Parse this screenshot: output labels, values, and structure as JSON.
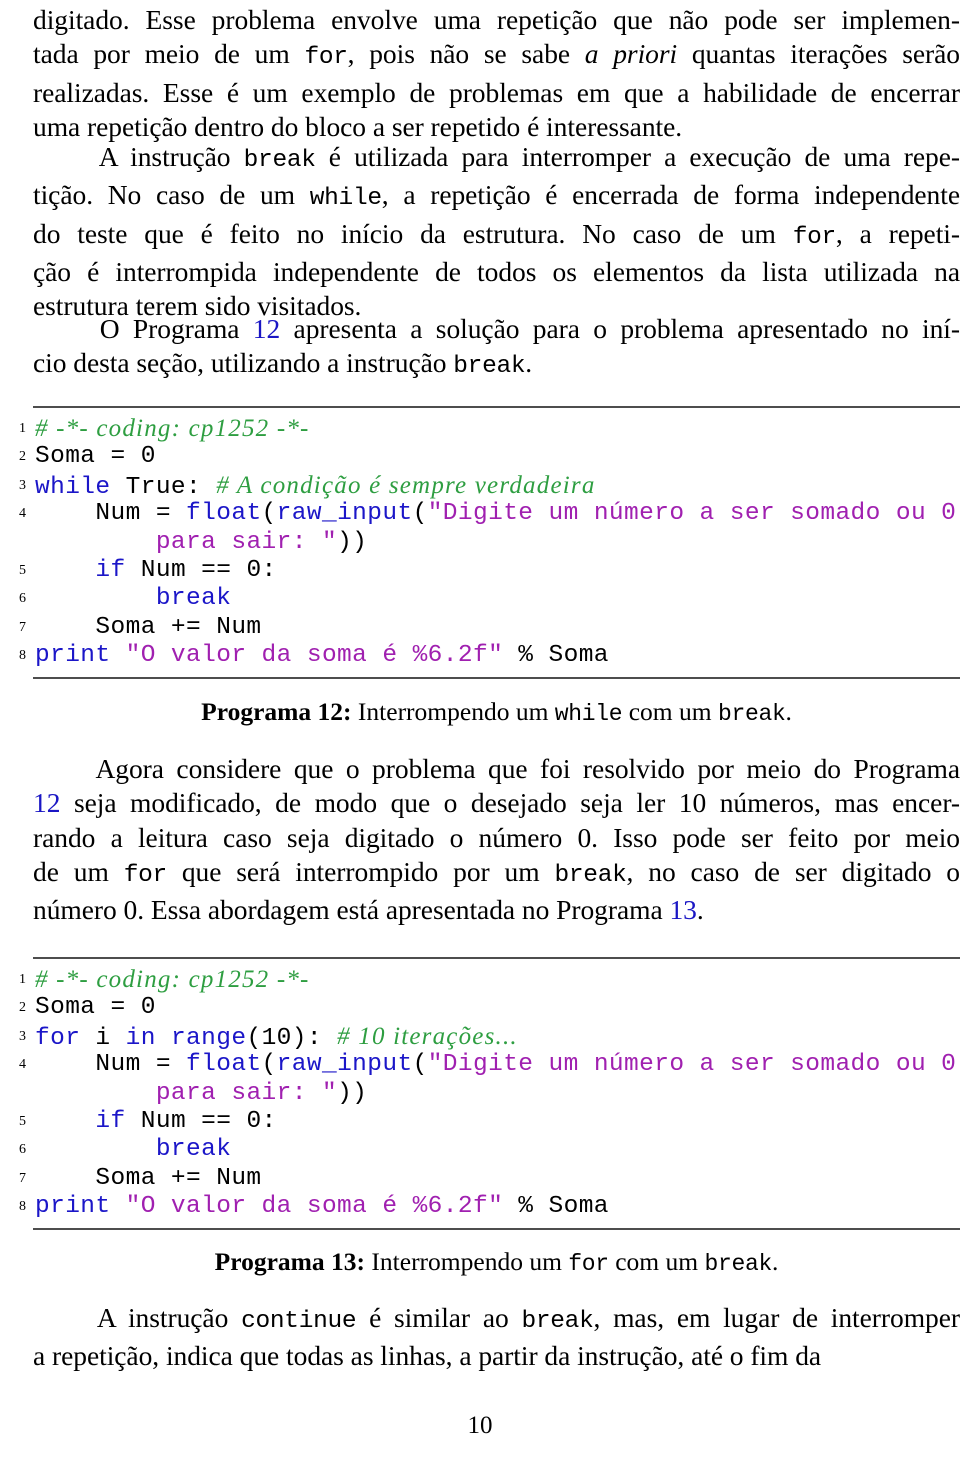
{
  "document": {
    "page_number": "10",
    "link_color": "#1a16c4",
    "code_colors": {
      "keyword": "#1b16c8",
      "builtin": "#1b16c8",
      "string": "#a020b0",
      "comment": "#2e9e41",
      "normal": "#000000",
      "rule": "#4d4d4d"
    }
  },
  "paragraphs": {
    "p1": {
      "lines": [
        [
          {
            "t": "digitado. Esse problema envolve uma repetição que não pode ser implemen-",
            "st": "r"
          }
        ],
        [
          {
            "t": "tada por meio de um ",
            "st": "r"
          },
          {
            "t": "for",
            "st": "tt"
          },
          {
            "t": ", pois não se sabe ",
            "st": "r"
          },
          {
            "t": "a priori",
            "st": "it"
          },
          {
            "t": " quantas iterações serão",
            "st": "r"
          }
        ],
        [
          {
            "t": "realizadas. Esse é um exemplo de problemas em que a habilidade de encerrar",
            "st": "r"
          }
        ],
        [
          {
            "t": "uma repetição dentro do bloco a ser repetido é interessante.",
            "st": "r"
          }
        ]
      ]
    },
    "p2": {
      "lines": [
        [
          {
            "t": "     A instrução ",
            "st": "r"
          },
          {
            "t": "break",
            "st": "tt"
          },
          {
            "t": " é utilizada para interromper a execução de uma repe-",
            "st": "r"
          }
        ],
        [
          {
            "t": "tição. No caso de um ",
            "st": "r"
          },
          {
            "t": "while",
            "st": "tt"
          },
          {
            "t": ", a repetição é encerrada de forma independente",
            "st": "r"
          }
        ],
        [
          {
            "t": "do teste que é feito no início da estrutura. No caso de um ",
            "st": "r"
          },
          {
            "t": "for",
            "st": "tt"
          },
          {
            "t": ", a repeti-",
            "st": "r"
          }
        ],
        [
          {
            "t": "ção é interrompida independente de todos os elementos da lista utilizada na",
            "st": "r"
          }
        ],
        [
          {
            "t": "estrutura terem sido visitados.",
            "st": "r"
          }
        ]
      ]
    },
    "p3": {
      "lines": [
        [
          {
            "t": "     O Programa ",
            "st": "r"
          },
          {
            "t": "12",
            "st": "ref"
          },
          {
            "t": " apresenta a solução para o problema apresentado no iní-",
            "st": "r"
          }
        ],
        [
          {
            "t": "cio desta seção, utilizando a instrução ",
            "st": "r"
          },
          {
            "t": "break",
            "st": "tt"
          },
          {
            "t": ".",
            "st": "r"
          }
        ]
      ]
    },
    "p4": {
      "lines": [
        [
          {
            "t": "     Agora considere que o problema que foi resolvido por meio do Programa",
            "st": "r"
          }
        ],
        [
          {
            "t": "12",
            "st": "ref"
          },
          {
            "t": " seja modificado, de modo que o desejado seja ler 10 números, mas encer-",
            "st": "r"
          }
        ],
        [
          {
            "t": "rando a leitura caso seja digitado o número 0. Isso pode ser feito por meio",
            "st": "r"
          }
        ],
        [
          {
            "t": "de um ",
            "st": "r"
          },
          {
            "t": "for",
            "st": "tt"
          },
          {
            "t": " que será interrompido por um ",
            "st": "r"
          },
          {
            "t": "break",
            "st": "tt"
          },
          {
            "t": ", no caso de ser digitado o",
            "st": "r"
          }
        ],
        [
          {
            "t": "número 0. Essa abordagem está apresentada no Programa ",
            "st": "r"
          },
          {
            "t": "13",
            "st": "ref"
          },
          {
            "t": ".",
            "st": "r"
          }
        ]
      ]
    },
    "p5": {
      "lines": [
        [
          {
            "t": "     A instrução ",
            "st": "r"
          },
          {
            "t": "continue",
            "st": "tt"
          },
          {
            "t": " é similar ao ",
            "st": "r"
          },
          {
            "t": "break",
            "st": "tt"
          },
          {
            "t": ", mas, em lugar de interromper",
            "st": "r"
          }
        ],
        [
          {
            "t": "a repetição, indica que todas as linhas, a partir da instrução, até o fim da",
            "st": "r"
          }
        ]
      ]
    }
  },
  "listing1": {
    "id": "programa-12",
    "lines": [
      {
        "no": "1",
        "tokens": [
          {
            "t": "# -*- coding: cp1252 -*-",
            "c": "c"
          }
        ]
      },
      {
        "no": "2",
        "tokens": [
          {
            "t": "Soma = 0",
            "c": "n"
          }
        ]
      },
      {
        "no": "3",
        "tokens": [
          {
            "t": "while",
            "c": "k"
          },
          {
            "t": " True: ",
            "c": "n"
          },
          {
            "t": "# A condição é sempre verdadeira",
            "c": "c"
          }
        ]
      },
      {
        "no": "4",
        "tokens": [
          {
            "t": "    Num = ",
            "c": "n"
          },
          {
            "t": "float",
            "c": "fn"
          },
          {
            "t": "(",
            "c": "n"
          },
          {
            "t": "raw_input",
            "c": "fn"
          },
          {
            "t": "(",
            "c": "n"
          },
          {
            "t": "\"Digite um número a ser somado ou 0",
            "c": "s"
          }
        ]
      },
      {
        "no": "",
        "tokens": [
          {
            "t": "        ",
            "c": "n"
          },
          {
            "t": "para sair: \"",
            "c": "s"
          },
          {
            "t": "))",
            "c": "n"
          }
        ]
      },
      {
        "no": "5",
        "tokens": [
          {
            "t": "    ",
            "c": "n"
          },
          {
            "t": "if",
            "c": "k"
          },
          {
            "t": " Num == 0:",
            "c": "n"
          }
        ]
      },
      {
        "no": "6",
        "tokens": [
          {
            "t": "        ",
            "c": "n"
          },
          {
            "t": "break",
            "c": "k"
          }
        ]
      },
      {
        "no": "7",
        "tokens": [
          {
            "t": "    Soma += Num",
            "c": "n"
          }
        ]
      },
      {
        "no": "8",
        "tokens": [
          {
            "t": "print",
            "c": "k"
          },
          {
            "t": " ",
            "c": "n"
          },
          {
            "t": "\"O valor da soma é %6.2f\"",
            "c": "s"
          },
          {
            "t": " % Soma",
            "c": "n"
          }
        ]
      }
    ]
  },
  "caption1": {
    "label": "Programa 12:",
    "text_before": " Interrompendo um ",
    "code1": "while",
    "text_middle": " com um ",
    "code2": "break",
    "text_after": "."
  },
  "listing2": {
    "id": "programa-13",
    "lines": [
      {
        "no": "1",
        "tokens": [
          {
            "t": "# -*- coding: cp1252 -*-",
            "c": "c"
          }
        ]
      },
      {
        "no": "2",
        "tokens": [
          {
            "t": "Soma = 0",
            "c": "n"
          }
        ]
      },
      {
        "no": "3",
        "tokens": [
          {
            "t": "for",
            "c": "k"
          },
          {
            "t": " i ",
            "c": "n"
          },
          {
            "t": "in",
            "c": "k"
          },
          {
            "t": " ",
            "c": "n"
          },
          {
            "t": "range",
            "c": "fn"
          },
          {
            "t": "(10): ",
            "c": "n"
          },
          {
            "t": "# 10 iterações...",
            "c": "c"
          }
        ]
      },
      {
        "no": "4",
        "tokens": [
          {
            "t": "    Num = ",
            "c": "n"
          },
          {
            "t": "float",
            "c": "fn"
          },
          {
            "t": "(",
            "c": "n"
          },
          {
            "t": "raw_input",
            "c": "fn"
          },
          {
            "t": "(",
            "c": "n"
          },
          {
            "t": "\"Digite um número a ser somado ou 0",
            "c": "s"
          }
        ]
      },
      {
        "no": "",
        "tokens": [
          {
            "t": "        ",
            "c": "n"
          },
          {
            "t": "para sair: \"",
            "c": "s"
          },
          {
            "t": "))",
            "c": "n"
          }
        ]
      },
      {
        "no": "5",
        "tokens": [
          {
            "t": "    ",
            "c": "n"
          },
          {
            "t": "if",
            "c": "k"
          },
          {
            "t": " Num == 0:",
            "c": "n"
          }
        ]
      },
      {
        "no": "6",
        "tokens": [
          {
            "t": "        ",
            "c": "n"
          },
          {
            "t": "break",
            "c": "k"
          }
        ]
      },
      {
        "no": "7",
        "tokens": [
          {
            "t": "    Soma += Num",
            "c": "n"
          }
        ]
      },
      {
        "no": "8",
        "tokens": [
          {
            "t": "print",
            "c": "k"
          },
          {
            "t": " ",
            "c": "n"
          },
          {
            "t": "\"O valor da soma é %6.2f\"",
            "c": "s"
          },
          {
            "t": " % Soma",
            "c": "n"
          }
        ]
      }
    ]
  },
  "caption2": {
    "label": "Programa 13:",
    "text_before": " Interrompendo um ",
    "code1": "for",
    "text_middle": " com um ",
    "code2": "break",
    "text_after": "."
  }
}
